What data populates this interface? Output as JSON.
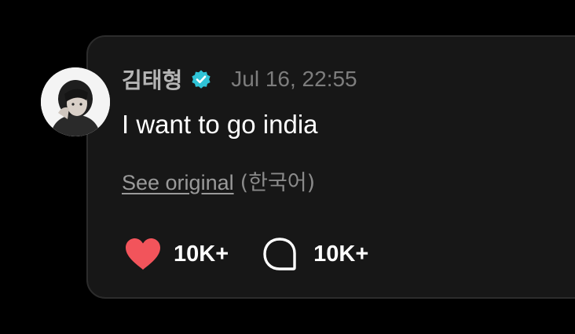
{
  "post": {
    "author": "김태형",
    "date": "Jul 16, 22:55",
    "message": "I want to go india",
    "see_original": "See original",
    "original_language": "(한국어)"
  },
  "actions": {
    "likes": "10K+",
    "comments": "10K+"
  },
  "icons": {
    "verified": "verified-badge-icon",
    "like": "heart-icon",
    "comment": "speech-bubble-icon"
  },
  "colors": {
    "background": "#000000",
    "card": "#171717",
    "verified": "#2fc3d6",
    "heart": "#f2545b"
  }
}
